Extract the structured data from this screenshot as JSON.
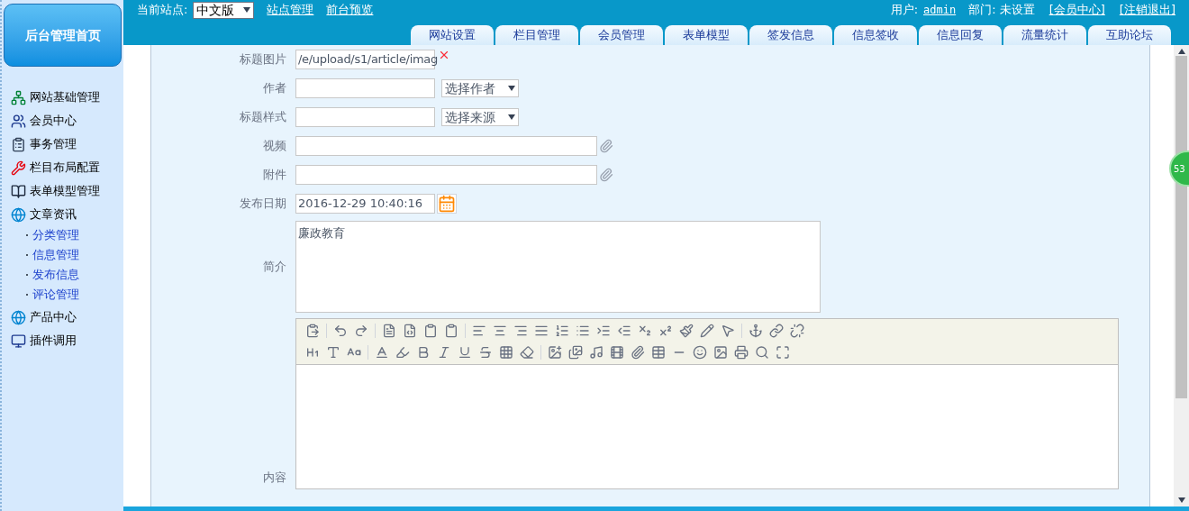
{
  "home_button": "后台管理首页",
  "header": {
    "site_label": "当前站点:",
    "site_select": "中文版",
    "links": [
      "站点管理",
      "前台预览"
    ],
    "user_label": "用户:",
    "user": "admin",
    "dept": "部门: 未设置",
    "user_links": [
      "[会员中心]",
      "[注销退出]"
    ]
  },
  "tabs": [
    {
      "label": "网站设置",
      "selected": false
    },
    {
      "label": "栏目管理",
      "selected": false
    },
    {
      "label": "会员管理",
      "selected": false
    },
    {
      "label": "表单模型",
      "selected": false
    },
    {
      "label": "签发信息",
      "selected": false
    },
    {
      "label": "信息签收",
      "selected": false
    },
    {
      "label": "信息回复",
      "selected": false
    },
    {
      "label": "流量统计",
      "selected": false
    },
    {
      "label": "互助论坛",
      "selected": false
    }
  ],
  "sidebar": {
    "items": [
      {
        "kind": "network",
        "label": "网站基础管理"
      },
      {
        "kind": "users",
        "label": "会员中心"
      },
      {
        "kind": "clipboard",
        "label": "事务管理"
      },
      {
        "kind": "tools",
        "label": "栏目布局配置"
      },
      {
        "kind": "book",
        "label": "表单模型管理"
      },
      {
        "kind": "globe",
        "label": "文章资讯",
        "children": [
          {
            "label": "分类管理"
          },
          {
            "label": "信息管理"
          },
          {
            "label": "发布信息"
          },
          {
            "label": "评论管理"
          }
        ]
      },
      {
        "kind": "globe",
        "label": "产品中心"
      },
      {
        "kind": "monitor",
        "label": "插件调用"
      }
    ]
  },
  "form": [
    {
      "kind": "image",
      "label": "标题图片",
      "value": "/e/upload/s1/article/imag"
    },
    {
      "kind": "select",
      "label": "作者",
      "select": "选择作者"
    },
    {
      "kind": "select",
      "label": "标题样式",
      "select": "选择来源"
    },
    {
      "kind": "attach",
      "label": "视频"
    },
    {
      "kind": "attach",
      "label": "附件"
    },
    {
      "kind": "date",
      "label": "发布日期",
      "value": "2016-12-29 10:40:16"
    },
    {
      "kind": "textarea",
      "label": "简介",
      "value": "廉政教育"
    },
    {
      "kind": "editor",
      "label": "内容"
    }
  ],
  "badge": "53"
}
